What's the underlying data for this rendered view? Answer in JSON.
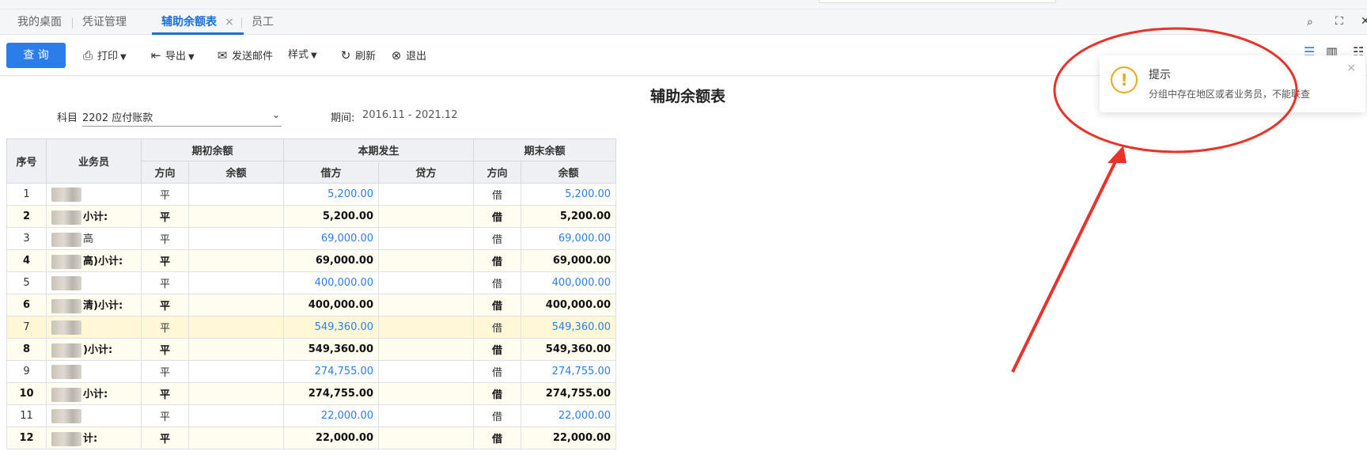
{
  "tabs": [
    {
      "label": "我的桌面"
    },
    {
      "label": "凭证管理"
    },
    {
      "label": "辅助余额表",
      "closable": "×"
    },
    {
      "label": "员工"
    }
  ],
  "toolbar": {
    "query": "查 询",
    "print": "打印",
    "export": "导出",
    "send_mail": "发送邮件",
    "style": "样式",
    "refresh": "刷新",
    "exit": "退出"
  },
  "report": {
    "title": "辅助余额表",
    "subject_label": "科目",
    "subject_value": "2202 应付账款",
    "period_label": "期间:",
    "period_value": "2016.11 - 2021.12"
  },
  "table": {
    "headers": {
      "seq": "序号",
      "staff": "业务员",
      "opening": "期初余额",
      "current": "本期发生",
      "closing": "期末余额",
      "direction": "方向",
      "balance": "余额",
      "debit": "借方",
      "credit": "贷方"
    },
    "rows": [
      {
        "seq": "1",
        "staff": "",
        "open_dir": "平",
        "open_bal": "",
        "debit": "5,200.00",
        "credit": "",
        "close_dir": "借",
        "close_bal": "5,200.00",
        "subtotal": false
      },
      {
        "seq": "2",
        "staff": "小计:",
        "open_dir": "平",
        "open_bal": "",
        "debit": "5,200.00",
        "credit": "",
        "close_dir": "借",
        "close_bal": "5,200.00",
        "subtotal": true
      },
      {
        "seq": "3",
        "staff": "高",
        "open_dir": "平",
        "open_bal": "",
        "debit": "69,000.00",
        "credit": "",
        "close_dir": "借",
        "close_bal": "69,000.00",
        "subtotal": false
      },
      {
        "seq": "4",
        "staff": "高)小计:",
        "open_dir": "平",
        "open_bal": "",
        "debit": "69,000.00",
        "credit": "",
        "close_dir": "借",
        "close_bal": "69,000.00",
        "subtotal": true
      },
      {
        "seq": "5",
        "staff": "",
        "open_dir": "平",
        "open_bal": "",
        "debit": "400,000.00",
        "credit": "",
        "close_dir": "借",
        "close_bal": "400,000.00",
        "subtotal": false
      },
      {
        "seq": "6",
        "staff": "清)小计:",
        "open_dir": "平",
        "open_bal": "",
        "debit": "400,000.00",
        "credit": "",
        "close_dir": "借",
        "close_bal": "400,000.00",
        "subtotal": true
      },
      {
        "seq": "7",
        "staff": "",
        "open_dir": "平",
        "open_bal": "",
        "debit": "549,360.00",
        "credit": "",
        "close_dir": "借",
        "close_bal": "549,360.00",
        "subtotal": false,
        "highlight": true
      },
      {
        "seq": "8",
        "staff": ")小计:",
        "open_dir": "平",
        "open_bal": "",
        "debit": "549,360.00",
        "credit": "",
        "close_dir": "借",
        "close_bal": "549,360.00",
        "subtotal": true
      },
      {
        "seq": "9",
        "staff": "",
        "open_dir": "平",
        "open_bal": "",
        "debit": "274,755.00",
        "credit": "",
        "close_dir": "借",
        "close_bal": "274,755.00",
        "subtotal": false
      },
      {
        "seq": "10",
        "staff": "小计:",
        "open_dir": "平",
        "open_bal": "",
        "debit": "274,755.00",
        "credit": "",
        "close_dir": "借",
        "close_bal": "274,755.00",
        "subtotal": true
      },
      {
        "seq": "11",
        "staff": "",
        "open_dir": "平",
        "open_bal": "",
        "debit": "22,000.00",
        "credit": "",
        "close_dir": "借",
        "close_bal": "22,000.00",
        "subtotal": false
      },
      {
        "seq": "12",
        "staff": "计:",
        "open_dir": "平",
        "open_bal": "",
        "debit": "22,000.00",
        "credit": "",
        "close_dir": "借",
        "close_bal": "22,000.00",
        "subtotal": true
      }
    ]
  },
  "toast": {
    "title": "提示",
    "message": "分组中存在地区或者业务员，不能联查",
    "icon": "warning-icon",
    "close": "×"
  },
  "colors": {
    "accent": "#2b7de9",
    "warning": "#f0a81a",
    "annotation": "#e8322a"
  }
}
